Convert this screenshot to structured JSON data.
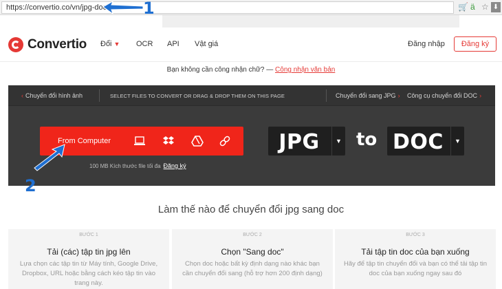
{
  "browser": {
    "url": "https://convertio.co/vn/jpg-doc/"
  },
  "header": {
    "brand": "Convertio",
    "nav": [
      {
        "label": "Đổi"
      },
      {
        "label": "OCR"
      },
      {
        "label": "API"
      },
      {
        "label": "Vật giá"
      }
    ],
    "login": "Đăng nhập",
    "signup": "Đăng ký"
  },
  "notice": {
    "text": "Bạn không cần công nhận chữ? —",
    "link": "Công nhận văn bản"
  },
  "panel": {
    "left_link": "Chuyển đổi hình ảnh",
    "middle": "SELECT FILES TO CONVERT OR DRAG & DROP THEM ON THIS PAGE",
    "right_link1": "Chuyển đổi sang JPG",
    "right_link2": "Công cụ chuyển đổi DOC",
    "choose_label": "From Computer",
    "source_icons": [
      "laptop-icon",
      "dropbox-icon",
      "google-drive-icon",
      "link-icon"
    ],
    "limit_text": "100 MB Kích thước file tối đa",
    "limit_link": "Đăng ký",
    "from_format": "JPG",
    "to_word": "to",
    "to_format": "DOC"
  },
  "howto": {
    "title": "Làm thế nào để chuyển đổi jpg sang doc",
    "steps": [
      {
        "num": "BƯỚC 1",
        "title": "Tải (các) tập tin jpg lên",
        "desc": "Lựa chọn các tập tin từ Máy tính, Google Drive, Dropbox, URL hoặc bằng cách kéo tập tin vào trang này."
      },
      {
        "num": "BƯỚC 2",
        "title": "Chọn \"Sang doc\"",
        "desc": "Chọn doc hoặc bất kỳ định dạng nào khác bạn cần chuyển đổi sang (hỗ trợ hơn 200 định dạng)"
      },
      {
        "num": "BƯỚC 3",
        "title": "Tải tập tin doc của bạn xuống",
        "desc": "Hãy để tập tin chuyển đổi và bạn có thể tải tập tin doc của bạn xuống ngay sau đó"
      }
    ]
  },
  "annotations": {
    "one": "1",
    "two": "2"
  },
  "colors": {
    "accent": "#f0251a",
    "annotation": "#1f6fd1",
    "panel": "#3b3b3b"
  }
}
